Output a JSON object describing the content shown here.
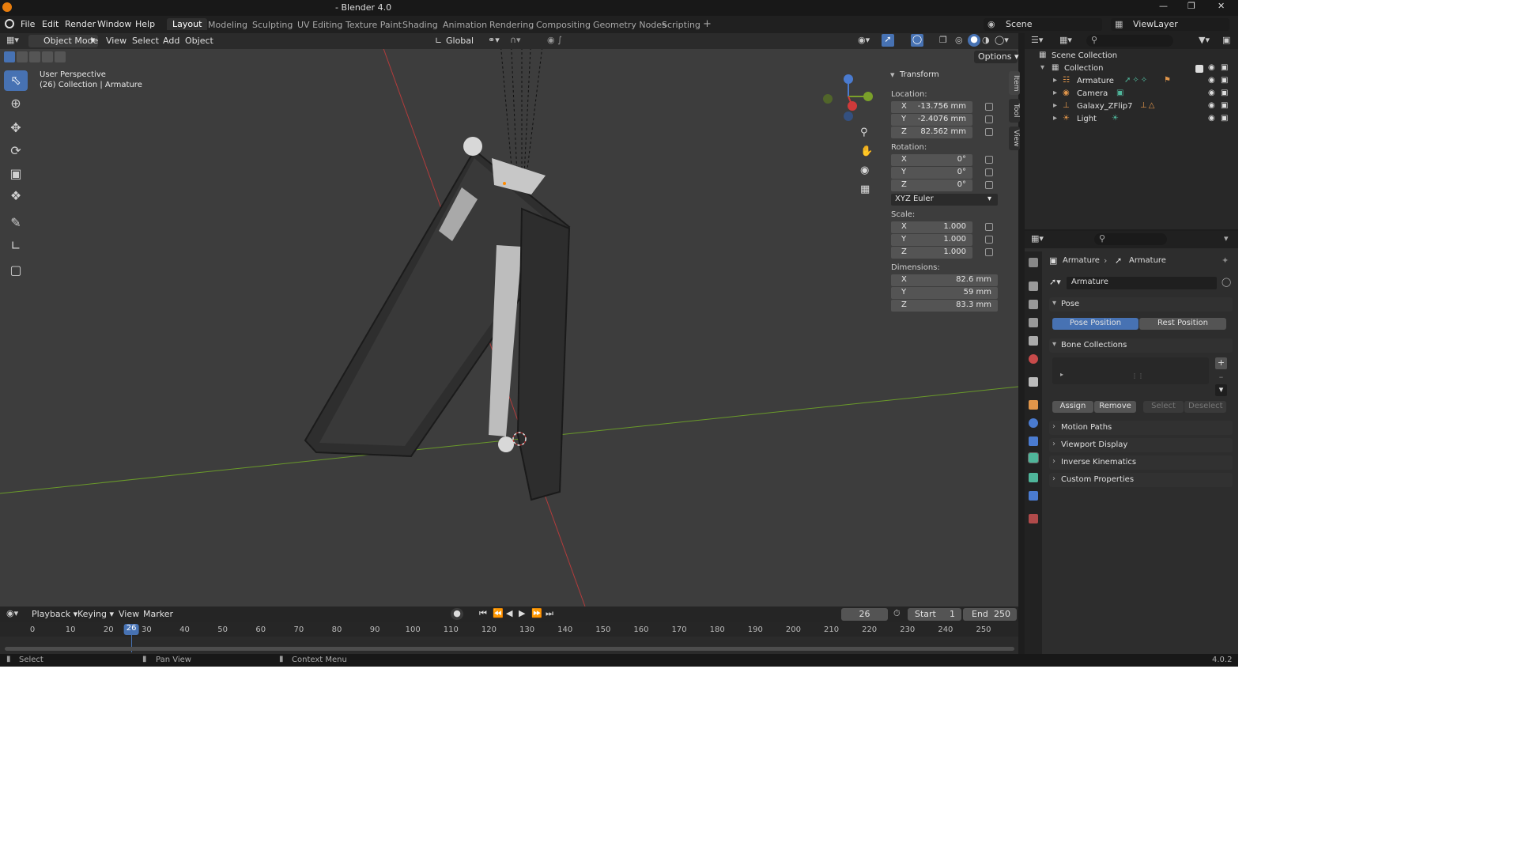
{
  "window": {
    "title": "- Blender 4.0"
  },
  "menu": [
    "File",
    "Edit",
    "Render",
    "Window",
    "Help"
  ],
  "workspaces": [
    "Layout",
    "Modeling",
    "Sculpting",
    "UV Editing",
    "Texture Paint",
    "Shading",
    "Animation",
    "Rendering",
    "Compositing",
    "Geometry Nodes",
    "Scripting"
  ],
  "active_workspace": "Layout",
  "scene": "Scene",
  "view_layer": "ViewLayer",
  "viewport": {
    "mode": "Object Mode",
    "header_menus": [
      "View",
      "Select",
      "Add",
      "Object"
    ],
    "transform_orientation": "Global",
    "options": "Options",
    "info_line1": "User Perspective",
    "info_line2": "(26) Collection | Armature",
    "gizmo": {
      "x": "X",
      "y": "Y",
      "z": "Z"
    }
  },
  "npanel": {
    "title": "Transform",
    "location_label": "Location:",
    "location": {
      "x": "-13.756 mm",
      "y": "-2.4076 mm",
      "z": "82.562 mm"
    },
    "rotation_label": "Rotation:",
    "rotation": {
      "x": "0°",
      "y": "0°",
      "z": "0°"
    },
    "rotation_mode": "XYZ Euler",
    "scale_label": "Scale:",
    "scale": {
      "x": "1.000",
      "y": "1.000",
      "z": "1.000"
    },
    "dimensions_label": "Dimensions:",
    "dimensions": {
      "x": "82.6 mm",
      "y": "59 mm",
      "z": "83.3 mm"
    },
    "axis": {
      "x": "X",
      "y": "Y",
      "z": "Z"
    },
    "tabs": [
      "Item",
      "Tool",
      "View"
    ]
  },
  "outliner": {
    "scene_collection": "Scene Collection",
    "collection": "Collection",
    "items": [
      "Armature",
      "Camera",
      "Galaxy_ZFlip7",
      "Light"
    ]
  },
  "properties": {
    "breadcrumb_obj": "Armature",
    "breadcrumb_data": "Armature",
    "datablock": "Armature",
    "pose_section": "Pose",
    "pose_position": "Pose Position",
    "rest_position": "Rest Position",
    "bone_collections": "Bone Collections",
    "assign": "Assign",
    "remove": "Remove",
    "select": "Select",
    "deselect": "Deselect",
    "panels": [
      "Motion Paths",
      "Viewport Display",
      "Inverse Kinematics",
      "Custom Properties"
    ]
  },
  "timeline": {
    "menus": [
      "Playback",
      "Keying",
      "View",
      "Marker"
    ],
    "current_frame": "26",
    "start_label": "Start",
    "start": "1",
    "end_label": "End",
    "end": "250",
    "ticks": [
      "0",
      "10",
      "20",
      "30",
      "40",
      "50",
      "60",
      "70",
      "80",
      "90",
      "100",
      "110",
      "120",
      "130",
      "140",
      "150",
      "160",
      "170",
      "180",
      "190",
      "200",
      "210",
      "220",
      "230",
      "240",
      "250"
    ],
    "playhead": "26"
  },
  "status": {
    "select": "Select",
    "pan": "Pan View",
    "context": "Context Menu",
    "version": "4.0.2"
  }
}
